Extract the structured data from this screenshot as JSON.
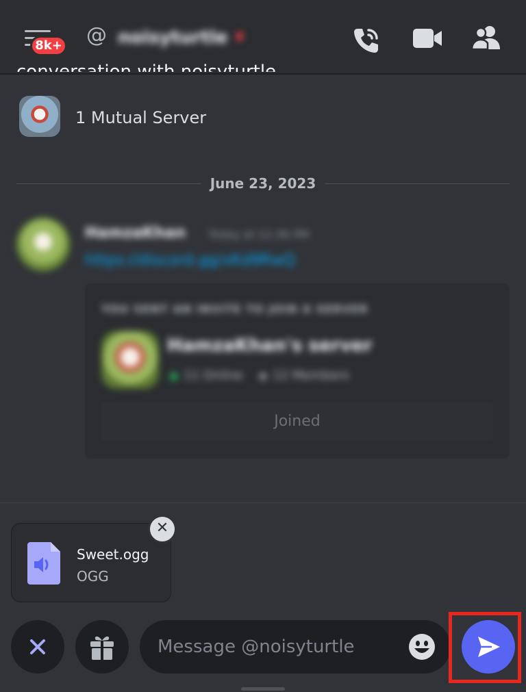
{
  "header": {
    "unread_badge": "8k+",
    "at_symbol": "@",
    "dm_name": "noisyturtle",
    "status_mark": "♦"
  },
  "intro": {
    "text": "conversation with noisyturtle.",
    "mutual_servers": "1 Mutual Server"
  },
  "divider": {
    "date": "June 23, 2023"
  },
  "message": {
    "author": "HamzaKhan",
    "timestamp": "Today at 11:36 PM",
    "link": "https://discord.gg/xKd9RwQ",
    "invite": {
      "heading": "YOU SENT AN INVITE TO JOIN A SERVER",
      "server_name": "HamzaKhan's server",
      "online": "11 Online",
      "members": "12 Members",
      "button_label": "Joined"
    }
  },
  "attachment": {
    "file_name": "Sweet.ogg",
    "file_type": "OGG",
    "remove_symbol": "✕"
  },
  "composer": {
    "placeholder": "Message @noisyturtle"
  },
  "colors": {
    "background": "#313338",
    "header": "#2b2d31",
    "accent": "#5865f2",
    "badge": "#f23f43",
    "online": "#23a55a",
    "link": "#00a8fc",
    "highlight": "#e8281f"
  },
  "icons": [
    "menu-icon",
    "phone-call-icon",
    "video-camera-icon",
    "members-icon",
    "audio-file-icon",
    "close-icon",
    "gift-icon",
    "emoji-icon",
    "send-icon"
  ]
}
